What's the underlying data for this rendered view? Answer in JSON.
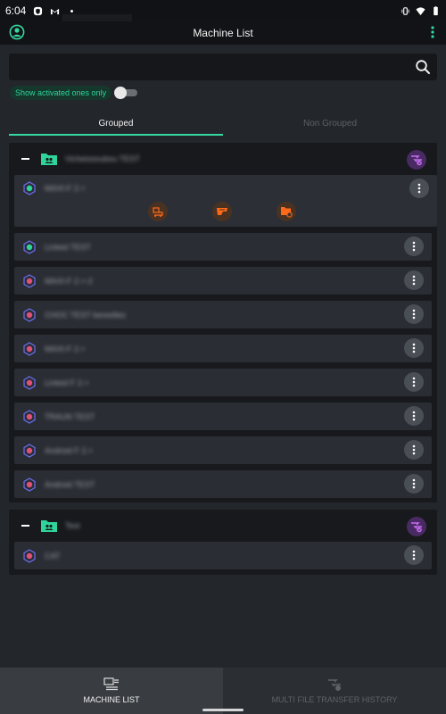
{
  "status_bar": {
    "time": "6:04",
    "icons": [
      "shield-badge-icon",
      "gmail-icon",
      "dot-icon",
      "vibrate-icon",
      "wifi-icon",
      "battery-icon"
    ]
  },
  "app_bar": {
    "title": "Machine List",
    "icons": [
      "profile-icon",
      "overflow-menu-icon"
    ]
  },
  "search": {
    "value": "",
    "placeholder": "",
    "icon": "search-icon"
  },
  "filter": {
    "label": "Show activated ones only",
    "enabled": false
  },
  "tabs": [
    {
      "label": "Grouped",
      "active": true
    },
    {
      "label": "Non Grouped",
      "active": false
    }
  ],
  "groups": [
    {
      "name": "Vicheissoubou TEST",
      "expanded": true,
      "machines": [
        {
          "name": "MAXI-F 2.+",
          "status_color": "#2fd49a",
          "expanded": true
        },
        {
          "name": "Linked TEST",
          "status_color": "#2fd49a",
          "expanded": false
        },
        {
          "name": "MAXI-F 2.+-2",
          "status_color": "#e05078",
          "expanded": false
        },
        {
          "name": "CHOC TEST bereelles",
          "status_color": "#e05078",
          "expanded": false
        },
        {
          "name": "MAXI-F 2.+",
          "status_color": "#e05078",
          "expanded": false
        },
        {
          "name": "Linked F 2.+",
          "status_color": "#e05078",
          "expanded": false
        },
        {
          "name": "TRAUN TEST",
          "status_color": "#e05078",
          "expanded": false
        },
        {
          "name": "Android F 2.+",
          "status_color": "#e05078",
          "expanded": false
        },
        {
          "name": "Android TEST",
          "status_color": "#e05078",
          "expanded": false
        }
      ]
    },
    {
      "name": "Test",
      "expanded": true,
      "machines": [
        {
          "name": "CAT",
          "status_color": "#e05078",
          "expanded": false
        }
      ]
    }
  ],
  "machine_actions": [
    "machine-transfer-icon",
    "send-files-icon",
    "folder-settings-icon"
  ],
  "bottom_nav": [
    {
      "label": "MACHINE LIST",
      "icon": "machine-list-icon",
      "active": true
    },
    {
      "label": "MULTI FILE TRANSFER HISTORY",
      "icon": "transfer-history-icon",
      "active": false
    }
  ],
  "colors": {
    "accent": "#38d6a0",
    "background": "#23262b",
    "group_badge": "#a64fd1",
    "action_orange": "#ff6a1a"
  }
}
